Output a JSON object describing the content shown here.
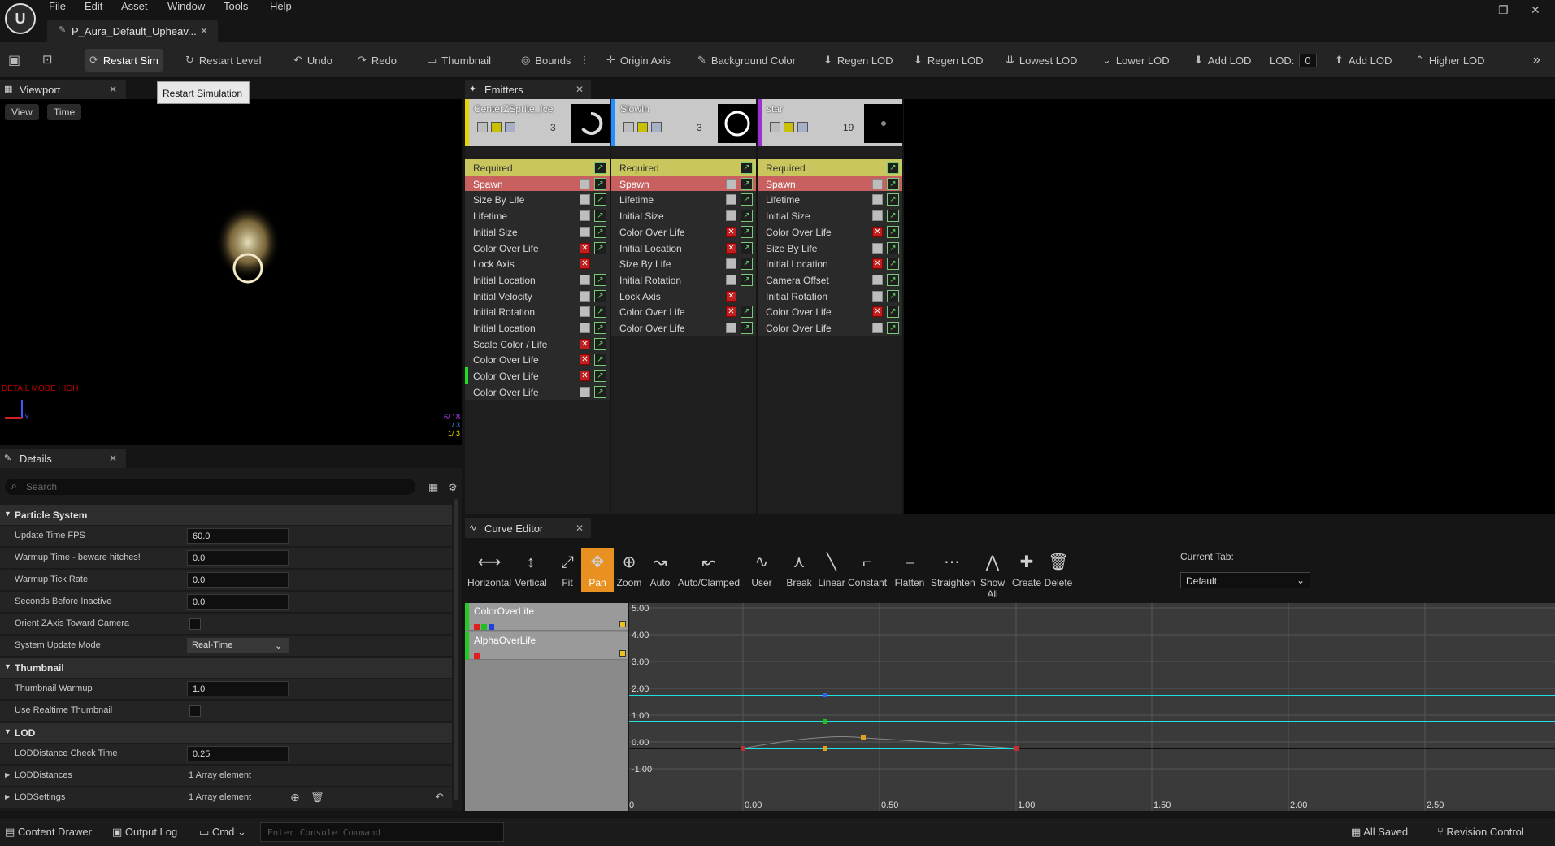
{
  "titlebar": {
    "logo": "U",
    "menu": [
      "File",
      "Edit",
      "Asset",
      "Window",
      "Tools",
      "Help"
    ],
    "doc_tab": "P_Aura_Default_Upheav...",
    "minimize": "—",
    "restore": "❐",
    "close": "✕"
  },
  "toolbar": {
    "items": [
      {
        "label": "Restart Sim",
        "icon": "restart-icon"
      },
      {
        "label": "Restart Level",
        "icon": "restart-level-icon"
      },
      {
        "label": "Undo",
        "icon": "undo-icon"
      },
      {
        "label": "Redo",
        "icon": "redo-icon"
      },
      {
        "label": "Thumbnail",
        "icon": "thumbnail-icon"
      },
      {
        "label": "Bounds",
        "icon": "bounds-icon"
      },
      {
        "label": "Origin Axis",
        "icon": "origin-axis-icon"
      },
      {
        "label": "Background Color",
        "icon": "background-color-icon"
      },
      {
        "label": "Regen LOD",
        "icon": "regen-lod-icon"
      },
      {
        "label": "Regen LOD",
        "icon": "regen-lod-icon"
      },
      {
        "label": "Lowest LOD",
        "icon": "lowest-lod-icon"
      },
      {
        "label": "Lower LOD",
        "icon": "lower-lod-icon"
      },
      {
        "label": "Add LOD",
        "icon": "add-lod-icon"
      },
      {
        "label": "Add LOD",
        "icon": "add-lod-icon"
      },
      {
        "label": "Higher LOD",
        "icon": "higher-lod-icon"
      }
    ],
    "lod_label": "LOD:",
    "lod_value": "0",
    "more": "»"
  },
  "viewport": {
    "tab": "Viewport",
    "view_btn": "View",
    "time_btn": "Time",
    "tooltip": "Restart Simulation",
    "detail_mode": "DETAIL MODE HIGH",
    "stats": [
      "6/ 18",
      "1/ 3",
      "1/ 3"
    ],
    "axis_label": "Y"
  },
  "details": {
    "tab": "Details",
    "search_placeholder": "Search",
    "sections": {
      "particle_system": "Particle System",
      "thumbnail": "Thumbnail",
      "lod": "LOD"
    },
    "props": {
      "update_fps": {
        "label": "Update Time FPS",
        "value": "60.0"
      },
      "warmup_time": {
        "label": "Warmup Time - beware hitches!",
        "value": "0.0"
      },
      "warmup_tick": {
        "label": "Warmup Tick Rate",
        "value": "0.0"
      },
      "seconds_inactive": {
        "label": "Seconds Before Inactive",
        "value": "0.0"
      },
      "orient_z": {
        "label": "Orient ZAxis Toward Camera"
      },
      "update_mode": {
        "label": "System Update Mode",
        "value": "Real-Time"
      },
      "thumb_warmup": {
        "label": "Thumbnail Warmup",
        "value": "1.0"
      },
      "realtime_thumb": {
        "label": "Use Realtime Thumbnail"
      },
      "lod_check": {
        "label": "LODDistance Check Time",
        "value": "0.25"
      },
      "lod_distances": {
        "label": "LODDistances",
        "value": "1 Array element"
      },
      "lod_settings": {
        "label": "LODSettings",
        "value": "1 Array element"
      }
    }
  },
  "emitters": {
    "tab": "Emitters",
    "columns": [
      {
        "name": "CenterZSprite_Ice",
        "count": "3",
        "color": "#e8d400",
        "modules": [
          {
            "label": "Required",
            "type": "req"
          },
          {
            "label": "Spawn",
            "type": "spawn"
          },
          {
            "label": "Size By Life",
            "x": false
          },
          {
            "label": "Lifetime",
            "x": false
          },
          {
            "label": "Initial Size",
            "x": false
          },
          {
            "label": "Color Over Life",
            "x": true
          },
          {
            "label": "Lock Axis",
            "x": true,
            "nograph": true
          },
          {
            "label": "Initial Location",
            "x": false
          },
          {
            "label": "Initial Velocity",
            "x": false
          },
          {
            "label": "Initial Rotation",
            "x": false
          },
          {
            "label": "Initial Location",
            "x": false
          },
          {
            "label": "Scale Color / Life",
            "x": true
          },
          {
            "label": "Color Over Life",
            "x": true
          },
          {
            "label": "Color Over Life",
            "x": true,
            "marker": true
          },
          {
            "label": "Color Over Life",
            "x": false
          }
        ]
      },
      {
        "name": "SlowIn",
        "count": "3",
        "color": "#1e90ff",
        "modules": [
          {
            "label": "Required",
            "type": "req"
          },
          {
            "label": "Spawn",
            "type": "spawn"
          },
          {
            "label": "Lifetime",
            "x": false
          },
          {
            "label": "Initial Size",
            "x": false
          },
          {
            "label": "Color Over Life",
            "x": true
          },
          {
            "label": "Initial Location",
            "x": true
          },
          {
            "label": "Size By Life",
            "x": false
          },
          {
            "label": "Initial Rotation",
            "x": false
          },
          {
            "label": "Lock Axis",
            "x": true,
            "nograph": true
          },
          {
            "label": "Color Over Life",
            "x": true
          },
          {
            "label": "Color Over Life",
            "x": false
          }
        ]
      },
      {
        "name": "star",
        "count": "19",
        "color": "#9a30d0",
        "modules": [
          {
            "label": "Required",
            "type": "req"
          },
          {
            "label": "Spawn",
            "type": "spawn"
          },
          {
            "label": "Lifetime",
            "x": false
          },
          {
            "label": "Initial Size",
            "x": false
          },
          {
            "label": "Color Over Life",
            "x": true
          },
          {
            "label": "Size By Life",
            "x": false
          },
          {
            "label": "Initial Location",
            "x": true
          },
          {
            "label": "Camera Offset",
            "x": false
          },
          {
            "label": "Initial Rotation",
            "x": false
          },
          {
            "label": "Color Over Life",
            "x": true
          },
          {
            "label": "Color Over Life",
            "x": false
          }
        ]
      }
    ]
  },
  "curve_editor": {
    "tab": "Curve Editor",
    "buttons": [
      "Horizontal",
      "Vertical",
      "Fit",
      "Pan",
      "Zoom",
      "Auto",
      "Auto/Clamped",
      "User",
      "Break",
      "Linear",
      "Constant",
      "Flatten",
      "Straighten",
      "Show All",
      "Create",
      "Delete"
    ],
    "current_tab_label": "Current Tab:",
    "current_tab_value": "Default",
    "curves": [
      "ColorOverLife",
      "AlphaOverLife"
    ],
    "y_labels": [
      "5.00",
      "4.00",
      "3.00",
      "2.00",
      "1.00",
      "0.00",
      "-1.00"
    ],
    "x_labels": [
      "0",
      "0.00",
      "0.50",
      "1.00",
      "1.50",
      "2.00",
      "2.50"
    ]
  },
  "statusbar": {
    "content_drawer": "Content Drawer",
    "output_log": "Output Log",
    "cmd": "Cmd",
    "console_placeholder": "Enter Console Command",
    "all_saved": "All Saved",
    "revision": "Revision Control"
  }
}
